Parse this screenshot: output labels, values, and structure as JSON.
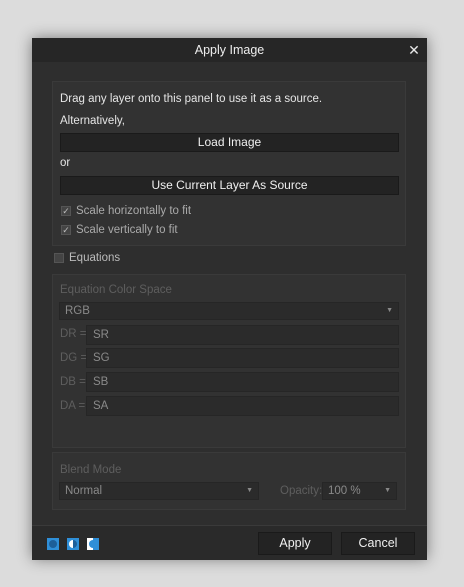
{
  "dialog": {
    "title": "Apply Image",
    "close_glyph": "✕"
  },
  "source": {
    "instruction": "Drag any layer onto this panel to use it as a source.",
    "alternatively": "Alternatively,",
    "load_image_label": "Load Image",
    "or": "or",
    "use_current_label": "Use Current Layer As Source",
    "scale_h_label": "Scale horizontally to fit",
    "scale_h_checked": true,
    "scale_v_label": "Scale vertically to fit",
    "scale_v_checked": true
  },
  "equations": {
    "label": "Equations",
    "checked": false,
    "color_space_label": "Equation Color Space",
    "color_space_value": "RGB",
    "rows": [
      {
        "label": "DR =",
        "value": "SR"
      },
      {
        "label": "DG =",
        "value": "SG"
      },
      {
        "label": "DB =",
        "value": "SB"
      },
      {
        "label": "DA =",
        "value": "SA"
      }
    ]
  },
  "blend": {
    "label": "Blend Mode",
    "mode_value": "Normal",
    "opacity_label": "Opacity:",
    "opacity_value": "100 %"
  },
  "footer": {
    "apply_label": "Apply",
    "cancel_label": "Cancel",
    "mode_icons": [
      "circle-mode-icon",
      "half-circle-mode-icon",
      "split-mode-icon"
    ],
    "accent_color": "#2f8fd8"
  }
}
